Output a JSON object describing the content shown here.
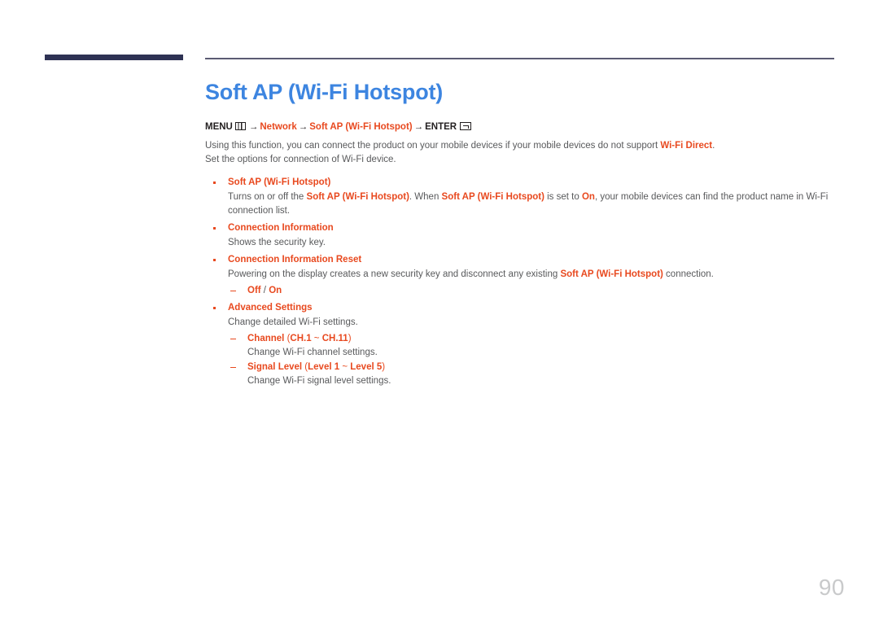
{
  "header": {
    "bar_color": "#2e3254",
    "rule_color": "#5b5b73"
  },
  "page": {
    "title": "Soft AP (Wi-Fi Hotspot)",
    "title_color": "#3d85e0",
    "accent_color": "#e8491f",
    "body_color": "#58595b",
    "number": "90"
  },
  "menu_path": {
    "menu_label": "MENU",
    "menu_icon": "menu-icon",
    "arrow1": "→",
    "item1": "Network",
    "arrow2": "→",
    "item2": "Soft AP (Wi-Fi Hotspot)",
    "arrow3": "→",
    "enter_label": "ENTER",
    "enter_icon": "enter-key-icon"
  },
  "intro": {
    "line1_part1": "Using this function, you can connect the product on your mobile devices if your mobile devices do not support ",
    "line1_accent": "Wi-Fi Direct",
    "line1_part2": ".",
    "line2": "Set the options for connection of Wi-Fi device."
  },
  "bullets": [
    {
      "title": "Soft AP (Wi-Fi Hotspot)",
      "desc_part1": "Turns on or off the ",
      "desc_accent1": "Soft AP (Wi-Fi Hotspot)",
      "desc_part2": ". When ",
      "desc_accent2": "Soft AP (Wi-Fi Hotspot)",
      "desc_part3": " is set to ",
      "desc_accent3": "On",
      "desc_part4": ", your mobile devices can find the product name in Wi-Fi connection list."
    },
    {
      "title": "Connection Information",
      "desc": "Shows the security key."
    },
    {
      "title": "Connection Information Reset",
      "desc_part1": "Powering on the display creates a new security key and disconnect any existing ",
      "desc_accent1": "Soft AP (Wi-Fi Hotspot)",
      "desc_part2": " connection.",
      "subs": [
        {
          "title_a": "Off",
          "slash": " / ",
          "title_b": "On"
        }
      ]
    },
    {
      "title": "Advanced Settings",
      "desc": "Change detailed Wi-Fi settings.",
      "subs": [
        {
          "name": "Channel",
          "paren_open": " (",
          "range_a": "CH.1",
          "tilde": " ~ ",
          "range_b": "CH.11",
          "paren_close": ")",
          "desc": "Change Wi-Fi channel settings."
        },
        {
          "name": "Signal Level",
          "paren_open": " (",
          "range_a": "Level 1",
          "tilde": " ~ ",
          "range_b": "Level 5",
          "paren_close": ")",
          "desc": "Change Wi-Fi signal level settings."
        }
      ]
    }
  ]
}
